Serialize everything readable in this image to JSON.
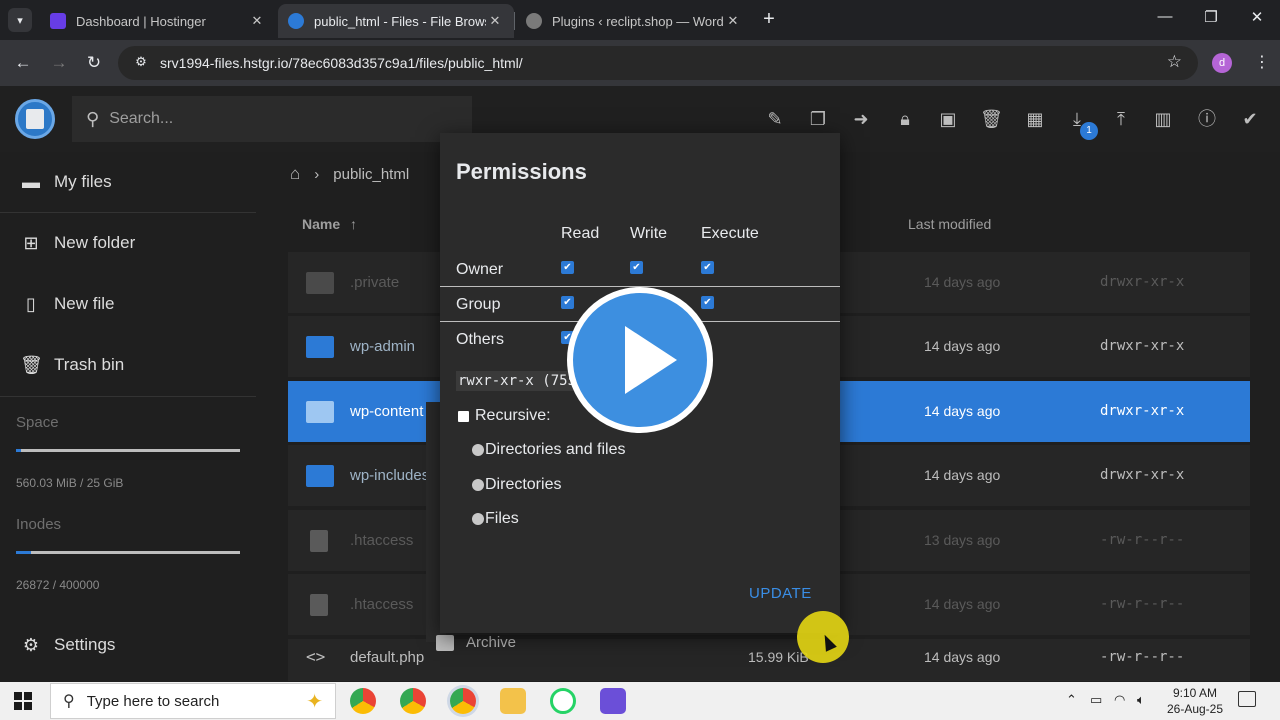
{
  "browser": {
    "tabs": [
      {
        "title": "Dashboard | Hostinger",
        "active": false
      },
      {
        "title": "public_html - Files - File Browser",
        "active": true
      },
      {
        "title": "Plugins ‹ reclipt.shop — WordPress",
        "active": false
      }
    ],
    "url": "srv1994-files.hstgr.io/78ec6083d357c9a1/files/public_html/",
    "profile_initial": "d"
  },
  "app": {
    "search_placeholder": "Search...",
    "download_badge": "1",
    "sidebar": {
      "items": [
        {
          "label": "My files",
          "icon": "folder-icon"
        },
        {
          "label": "New folder",
          "icon": "new-folder-icon"
        },
        {
          "label": "New file",
          "icon": "new-file-icon"
        },
        {
          "label": "Trash bin",
          "icon": "trash-icon"
        }
      ],
      "space_label": "Space",
      "space_value": "560.03 MiB / 25 GiB",
      "space_fraction": 0.022,
      "inodes_label": "Inodes",
      "inodes_value": "26872 / 400000",
      "inodes_fraction": 0.067,
      "settings_label": "Settings"
    },
    "breadcrumb": {
      "folder": "public_html"
    },
    "columns": {
      "name": "Name",
      "modified": "Last modified"
    },
    "rows": [
      {
        "name": ".private",
        "type": "folder",
        "size": "",
        "modified": "14 days ago",
        "perm": "drwxr-xr-x",
        "dim": true
      },
      {
        "name": "wp-admin",
        "type": "folder",
        "size": "",
        "modified": "14 days ago",
        "perm": "drwxr-xr-x",
        "dim": false
      },
      {
        "name": "wp-content",
        "type": "folder",
        "size": "",
        "modified": "14 days ago",
        "perm": "drwxr-xr-x",
        "dim": false,
        "selected": true
      },
      {
        "name": "wp-includes",
        "type": "folder",
        "size": "",
        "modified": "14 days ago",
        "perm": "drwxr-xr-x",
        "dim": false
      },
      {
        "name": ".htaccess",
        "type": "file",
        "size": "",
        "modified": "13 days ago",
        "perm": "-rw-r--r--",
        "dim": true
      },
      {
        "name": ".htaccess",
        "type": "file",
        "size": "",
        "modified": "14 days ago",
        "perm": "-rw-r--r--",
        "dim": true
      },
      {
        "name": "default.php",
        "type": "code",
        "size": "15.99 KiB",
        "modified": "14 days ago",
        "perm": "-rw-r--r--",
        "dim": false
      }
    ],
    "context_menu": {
      "archive_label": "Archive"
    }
  },
  "modal": {
    "title": "Permissions",
    "col_read": "Read",
    "col_write": "Write",
    "col_execute": "Execute",
    "rows": [
      {
        "label": "Owner"
      },
      {
        "label": "Group"
      },
      {
        "label": "Others"
      }
    ],
    "perm_text": "rwxr-xr-x (755)",
    "recursive_label": "Recursive:",
    "options": [
      "Directories and files",
      "Directories",
      "Files"
    ],
    "update_label": "UPDATE"
  },
  "taskbar": {
    "search_placeholder": "Type here to search",
    "time": "9:10 AM",
    "date": "26-Aug-25"
  },
  "colors": {
    "accent": "#2c7ad6",
    "play": "#3d8fe0",
    "cursor_highlight": "#e1d214"
  }
}
